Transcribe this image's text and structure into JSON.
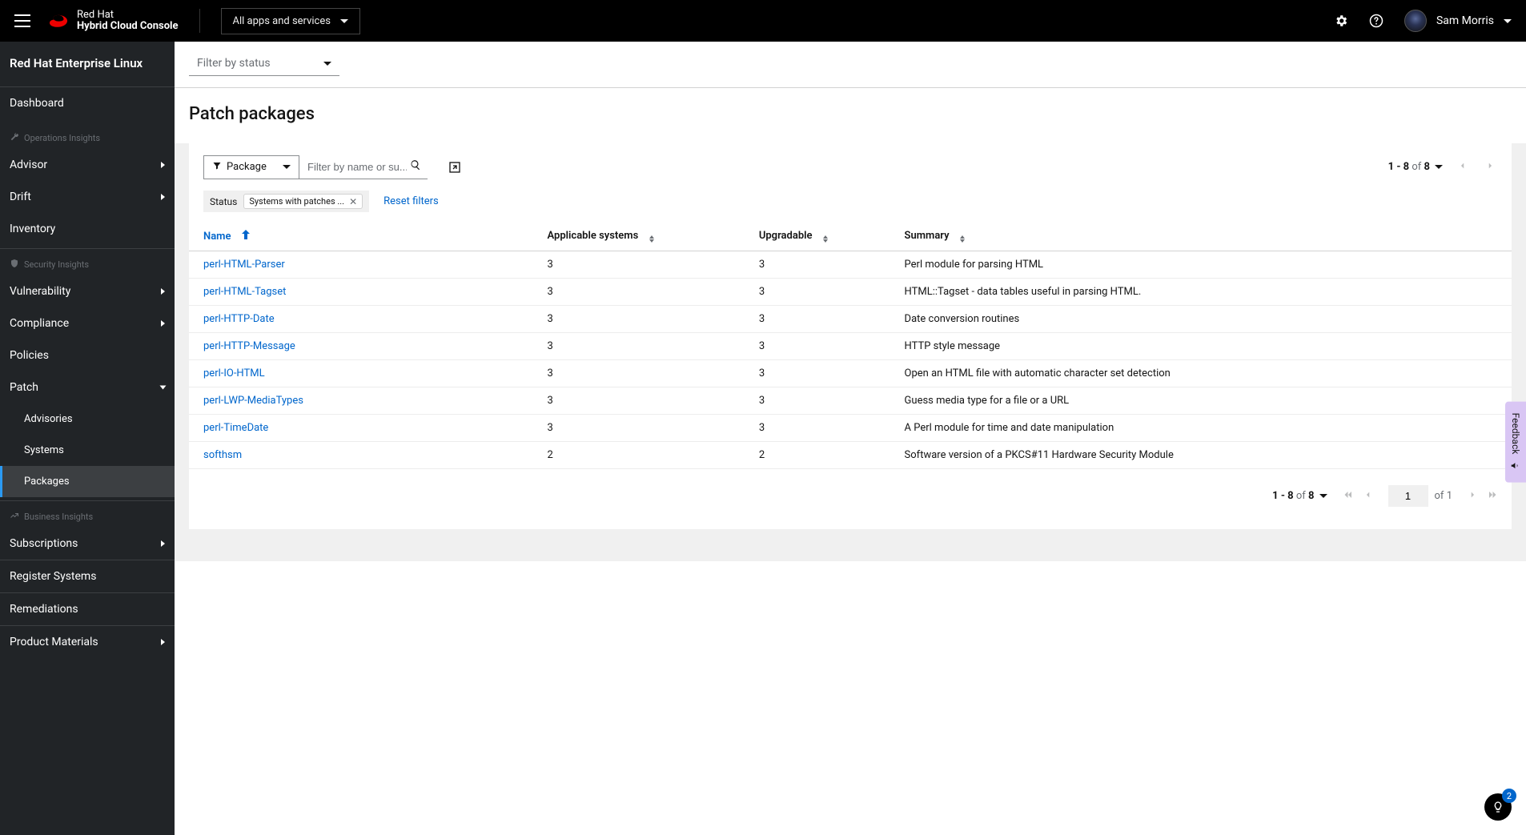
{
  "masthead": {
    "brand_line1": "Red Hat",
    "brand_line2": "Hybrid Cloud Console",
    "apps_toggle": "All apps and services",
    "username": "Sam Morris"
  },
  "sidebar": {
    "context": "Red Hat Enterprise Linux",
    "dashboard": "Dashboard",
    "sections": {
      "ops": "Operations Insights",
      "sec": "Security Insights",
      "biz": "Business Insights"
    },
    "items": {
      "advisor": "Advisor",
      "drift": "Drift",
      "inventory": "Inventory",
      "vulnerability": "Vulnerability",
      "compliance": "Compliance",
      "policies": "Policies",
      "patch": "Patch",
      "patch_advisories": "Advisories",
      "patch_systems": "Systems",
      "patch_packages": "Packages",
      "subscriptions": "Subscriptions",
      "register": "Register Systems",
      "remediations": "Remediations",
      "materials": "Product Materials"
    }
  },
  "filters": {
    "status_placeholder": "Filter by status",
    "attribute_label": "Package",
    "search_placeholder": "Filter by name or su...",
    "chip_category": "Status",
    "chip_value": "Systems with patches ...",
    "reset": "Reset filters"
  },
  "page": {
    "title": "Patch packages"
  },
  "table": {
    "columns": {
      "name": "Name",
      "applicable": "Applicable systems",
      "upgradable": "Upgradable",
      "summary": "Summary"
    },
    "rows": [
      {
        "name": "perl-HTML-Parser",
        "applicable": "3",
        "upgradable": "3",
        "summary": "Perl module for parsing HTML"
      },
      {
        "name": "perl-HTML-Tagset",
        "applicable": "3",
        "upgradable": "3",
        "summary": "HTML::Tagset - data tables useful in parsing HTML."
      },
      {
        "name": "perl-HTTP-Date",
        "applicable": "3",
        "upgradable": "3",
        "summary": "Date conversion routines"
      },
      {
        "name": "perl-HTTP-Message",
        "applicable": "3",
        "upgradable": "3",
        "summary": "HTTP style message"
      },
      {
        "name": "perl-IO-HTML",
        "applicable": "3",
        "upgradable": "3",
        "summary": "Open an HTML file with automatic character set detection"
      },
      {
        "name": "perl-LWP-MediaTypes",
        "applicable": "3",
        "upgradable": "3",
        "summary": "Guess media type for a file or a URL"
      },
      {
        "name": "perl-TimeDate",
        "applicable": "3",
        "upgradable": "3",
        "summary": "A Perl module for time and date manipulation"
      },
      {
        "name": "softhsm",
        "applicable": "2",
        "upgradable": "2",
        "summary": "Software version of a PKCS#11 Hardware Security Module"
      }
    ]
  },
  "pagination": {
    "compact_range": "1 - 8",
    "compact_of": " of ",
    "compact_total": "8",
    "footer_range": "1 - 8",
    "footer_of": " of ",
    "footer_total": "8",
    "page_input": "1",
    "page_of": "of ",
    "page_total": "1"
  },
  "misc": {
    "feedback": "Feedback",
    "bulb_badge": "2"
  }
}
